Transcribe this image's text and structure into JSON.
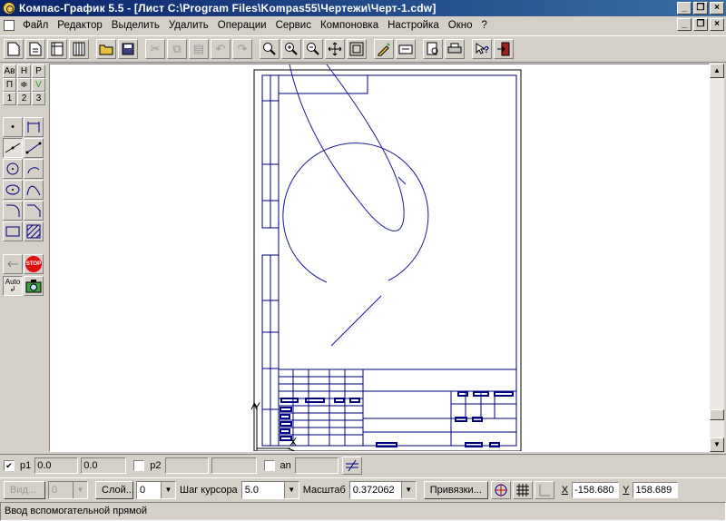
{
  "window": {
    "title": "Компас-График 5.5 - [Лист C:\\Program Files\\Kompas55\\Чертежи\\Черт-1.cdw]",
    "controls": [
      "_",
      "❐",
      "×"
    ]
  },
  "menu": {
    "items": [
      "Файл",
      "Редактор",
      "Выделить",
      "Удалить",
      "Операции",
      "Сервис",
      "Компоновка",
      "Настройка",
      "Окно",
      "?"
    ]
  },
  "toolbar": {
    "buttons": [
      "new-sheet-icon",
      "new-fragment-icon",
      "new-spec-icon",
      "new-text-icon",
      "open-icon",
      "save-icon",
      "cut-icon",
      "copy-icon",
      "paste-icon",
      "undo-icon",
      "redo-icon",
      "zoom-window-icon",
      "zoom-in-icon",
      "zoom-out-icon",
      "pan-icon",
      "zoom-all-icon",
      "properties-icon",
      "layers-icon",
      "print-preview-icon",
      "print-icon",
      "help-icon",
      "exit-icon"
    ]
  },
  "left_tools": {
    "row1": [
      "Ав",
      "Н",
      "Р"
    ],
    "row2": [
      "П",
      "≑",
      "V"
    ],
    "row3": [
      "1",
      "2",
      "3"
    ],
    "auto_label": "Auto",
    "stop_label": "STOP"
  },
  "drawing": {
    "axis_y": "Y",
    "axis_x": "X"
  },
  "status1": {
    "p1_label": "p1",
    "p1_x": "0.0",
    "p1_y": "0.0",
    "p2_label": "p2",
    "an_label": "an"
  },
  "status2": {
    "view_button": "Вид...",
    "view_value": "0",
    "layer_button": "Слой...",
    "layer_value": "0",
    "step_label": "Шаг курсора",
    "step_value": "5.0",
    "scale_label": "Масштаб",
    "scale_value": "0.372062",
    "snaps_button": "Привязки...",
    "x_label": "X",
    "x_value": "-158.680",
    "y_label": "Y",
    "y_value": "158.689"
  },
  "status3": {
    "message": "Ввод вспомогательной прямой"
  },
  "colors": {
    "titlebar": "#0a246a",
    "geometry": "#1a1aa0",
    "frame": "#000080",
    "face": "#d4d0c8"
  }
}
